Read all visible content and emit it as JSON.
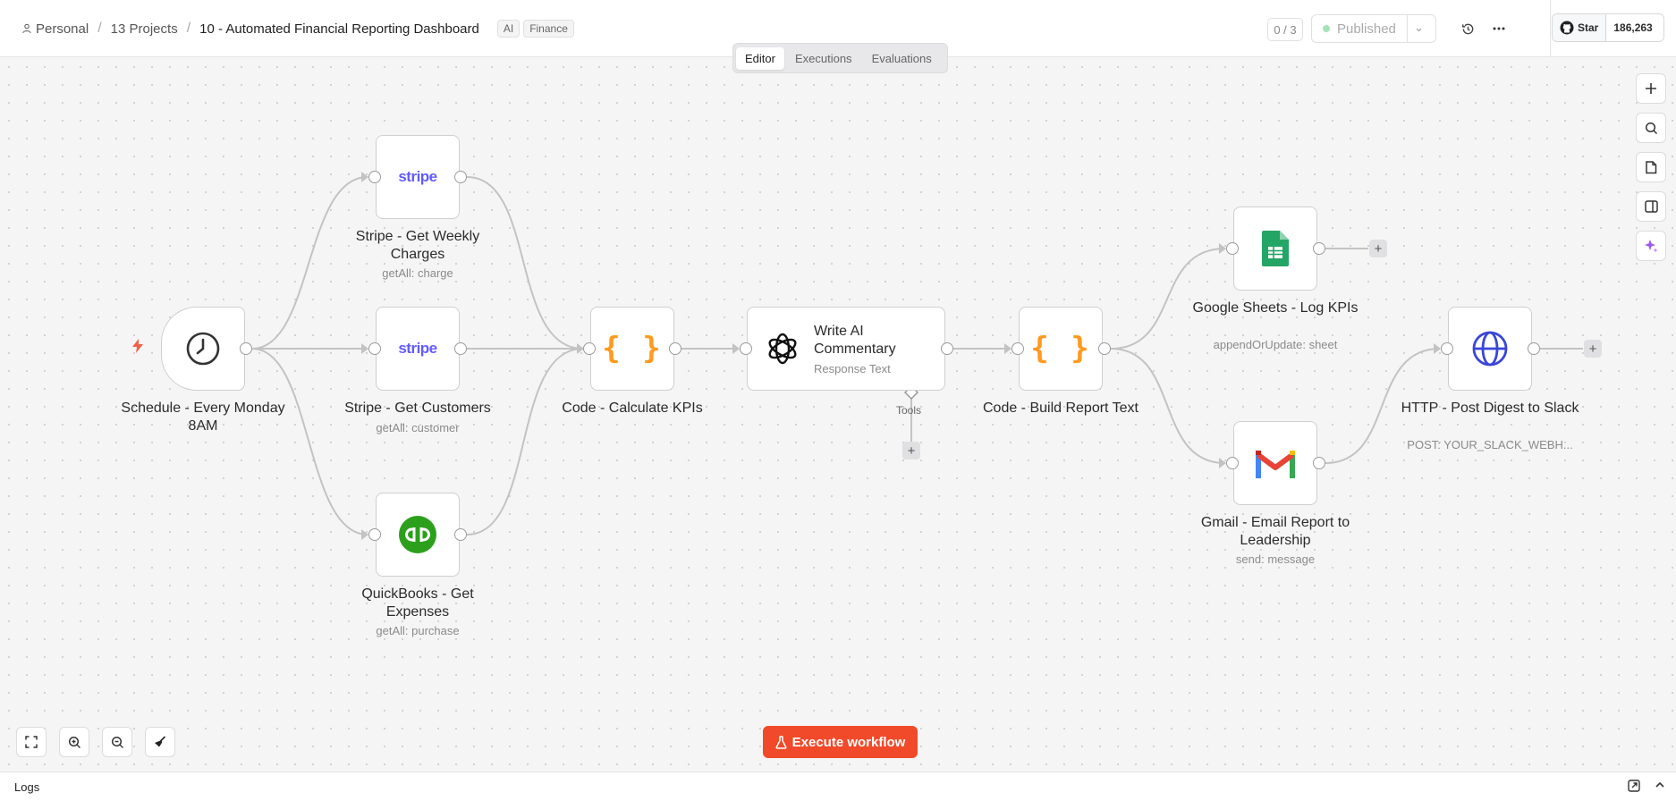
{
  "header": {
    "breadcrumb": {
      "personal": "Personal",
      "projects": "13 Projects",
      "workflow": "10 - Automated Financial Reporting Dashboard"
    },
    "tags": [
      "AI",
      "Finance"
    ],
    "counter": "0 / 3",
    "publish_status": "Published",
    "github": {
      "star_label": "Star",
      "count": "186,263"
    }
  },
  "tabs": [
    "Editor",
    "Executions",
    "Evaluations"
  ],
  "active_tab": "Editor",
  "nodes": {
    "schedule": {
      "title": "Schedule - Every Monday 8AM",
      "icon": "clock-icon"
    },
    "stripe_charges": {
      "title": "Stripe - Get Weekly Charges",
      "subtitle": "getAll: charge",
      "icon_text": "stripe"
    },
    "stripe_customers": {
      "title": "Stripe - Get Customers",
      "subtitle": "getAll: customer",
      "icon_text": "stripe"
    },
    "quickbooks": {
      "title": "QuickBooks - Get Expenses",
      "subtitle": "getAll: purchase",
      "icon": "quickbooks-icon"
    },
    "code_kpis": {
      "title": "Code - Calculate KPIs",
      "icon_text": "{ }"
    },
    "ai_commentary": {
      "title": "Write AI Commentary",
      "subtitle": "Response Text",
      "icon": "openai-icon",
      "tools_label": "Tools"
    },
    "code_report": {
      "title": "Code - Build Report Text",
      "icon_text": "{ }"
    },
    "sheets": {
      "title": "Google Sheets - Log KPIs",
      "subtitle": "appendOrUpdate: sheet",
      "icon": "google-sheets-icon"
    },
    "gmail": {
      "title": "Gmail - Email Report to Leadership",
      "subtitle": "send: message",
      "icon": "gmail-icon"
    },
    "http": {
      "title": "HTTP - Post Digest to Slack",
      "subtitle": "POST: YOUR_SLACK_WEBH...",
      "icon": "globe-icon"
    }
  },
  "execute_button": "Execute workflow",
  "logs": {
    "label": "Logs"
  },
  "colors": {
    "accent": "#f04a2a",
    "stripe": "#635bff",
    "code": "#ff9a1f",
    "quickbooks": "#2ca01c",
    "globe": "#3a46d9"
  }
}
